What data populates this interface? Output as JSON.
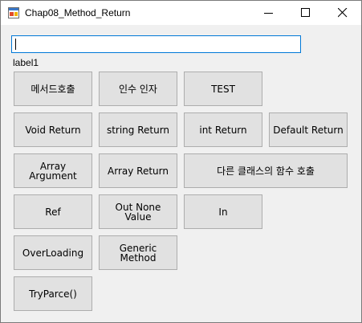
{
  "window": {
    "title": "Chap08_Method_Return",
    "controls": {
      "minimize": "minimize-icon",
      "maximize": "maximize-icon",
      "close": "close-icon"
    }
  },
  "textbox": {
    "value": "",
    "placeholder": ""
  },
  "label": {
    "text": "label1"
  },
  "buttons": {
    "method_call": "메서드호출",
    "arg_param": "인수 인자",
    "test": "TEST",
    "void_return": "Void Return",
    "string_return": "string Return",
    "int_return": "int Return",
    "default_return": "Default Return",
    "array_argument": "Array\nArgument",
    "array_return": "Array Return",
    "other_class_call": "다른 클래스의 함수 호출",
    "ref": "Ref",
    "out_none_value": "Out None\nValue",
    "in": "In",
    "overloading": "OverLoading",
    "generic_method": "Generic\nMethod",
    "tryparce": "TryParce()"
  },
  "colors": {
    "accent": "#0078d7",
    "button_bg": "#e1e1e1",
    "button_border": "#adadad",
    "window_bg": "#f0f0f0"
  }
}
